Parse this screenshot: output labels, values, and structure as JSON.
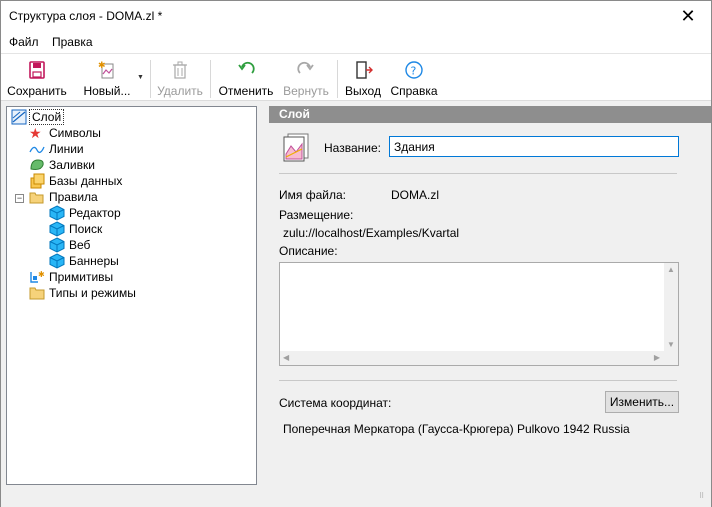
{
  "window": {
    "title": "Структура слоя - DOMA.zl *",
    "close_glyph": "✕"
  },
  "menu": {
    "file": "Файл",
    "edit": "Правка"
  },
  "toolbar": {
    "save": "Сохранить",
    "new": "Новый...",
    "delete": "Удалить",
    "undo": "Отменить",
    "redo": "Вернуть",
    "exit": "Выход",
    "help": "Справка"
  },
  "tree": {
    "root": "Слой",
    "items": [
      "Символы",
      "Линии",
      "Заливки",
      "Базы данных",
      "Правила",
      "Редактор",
      "Поиск",
      "Веб",
      "Баннеры",
      "Примитивы",
      "Типы и режимы"
    ]
  },
  "panel": {
    "header": "Слой",
    "name_label": "Название:",
    "name_value": "Здания",
    "filename_label": "Имя файла:",
    "filename_value": "DOMA.zl",
    "location_label": "Размещение:",
    "location_value": "zulu://localhost/Examples/Kvartal",
    "description_label": "Описание:",
    "coord_label": "Система координат:",
    "change_button": "Изменить...",
    "coord_value": "Поперечная Меркатора (Гаусса-Крюгера) Pulkovo 1942 Russia"
  },
  "colors": {
    "accent": "#0078d7",
    "header_bg": "#8e8e8e",
    "save_icon": "#c2185b",
    "undo_icon": "#2e9e3e"
  }
}
